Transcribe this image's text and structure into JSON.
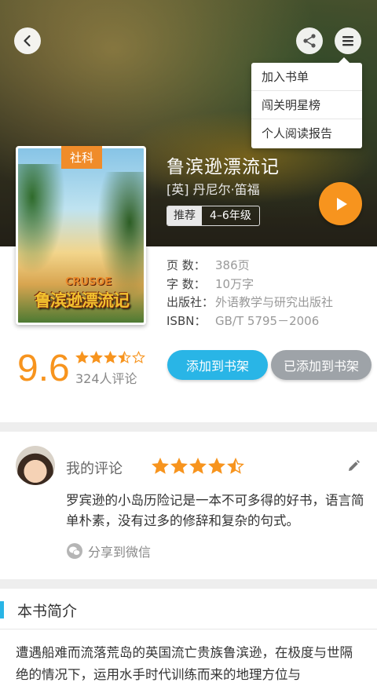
{
  "header": {
    "back_icon": "chevron-left-icon",
    "share_icon": "share-icon",
    "menu_icon": "menu-icon"
  },
  "menu": {
    "items": [
      "加入书单",
      "闯关明星榜",
      "个人阅读报告"
    ]
  },
  "book": {
    "category": "社科",
    "cover_title": "鲁滨逊漂流记",
    "cover_subtitle": "CRUSOE",
    "title": "鲁滨逊漂流记",
    "author": "[英] 丹尼尔·笛福",
    "recommend_label": "推荐",
    "grade": "4–6年级",
    "meta": [
      {
        "key": "页    数：",
        "value": "386页"
      },
      {
        "key": "字    数：",
        "value": "10万字"
      },
      {
        "key": "出版社：",
        "value": "外语教学与研究出版社"
      },
      {
        "key": "ISBN：",
        "value": "GB/T 5795－2006"
      }
    ]
  },
  "rating": {
    "score": "9.6",
    "stars": 3.5,
    "review_count": "324人评论"
  },
  "actions": {
    "add_to_shelf": "添加到书架",
    "added_to_shelf": "已添加到书架"
  },
  "my_review": {
    "label": "我的评论",
    "stars": 4.5,
    "text": "罗宾逊的小岛历险记是一本不可多得的好书，语言简单朴素，没有过多的修辞和复杂的句式。",
    "share_label": "分享到微信"
  },
  "synopsis": {
    "title": "本书简介",
    "text": "遭遇船难而流落荒岛的英国流亡贵族鲁滨逊，在极度与世隔绝的情况下，运用水手时代训练而来的地理方位与"
  },
  "colors": {
    "accent_blue": "#29b5e6",
    "accent_orange": "#f7941e",
    "gray_button": "#9ea3a8"
  }
}
